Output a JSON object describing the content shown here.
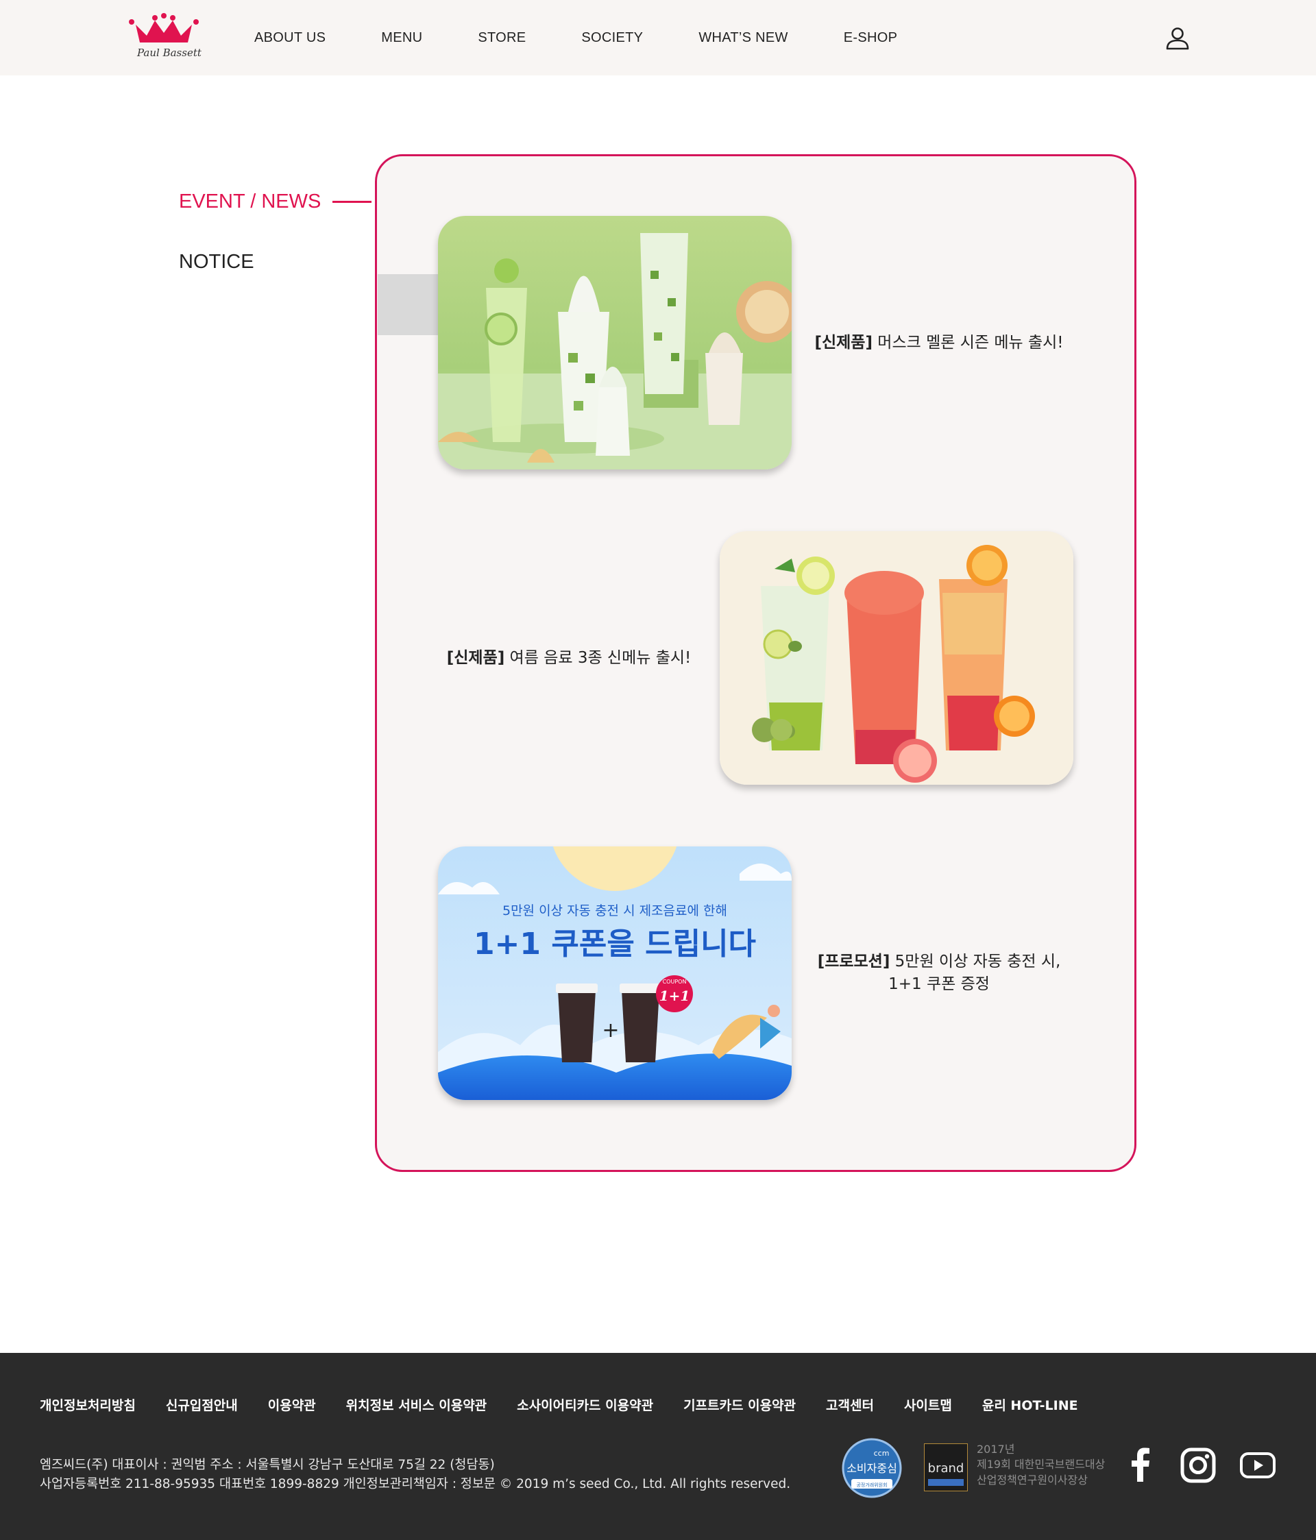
{
  "header": {
    "logo_text": "Paul Bassett",
    "nav": [
      "ABOUT US",
      "MENU",
      "STORE",
      "SOCIETY",
      "WHAT’S NEW",
      "E-SHOP"
    ]
  },
  "sidebar": {
    "active": "EVENT / NEWS",
    "notice": "NOTICE"
  },
  "posts": [
    {
      "tag": "[신제품]",
      "title": " 머스크 멜론 시즌 메뉴 출시!"
    },
    {
      "tag": "[신제품]",
      "title": " 여름 음료 3종 신메뉴 출시!"
    },
    {
      "tag": "[프로모션]",
      "title": " 5만원 이상 자동 충전 시,",
      "title2": "1+1 쿠폰 증정"
    }
  ],
  "promo_banner": {
    "subtitle": "5만원 이상 자동 충전 시 제조음료에 한해",
    "headline": "1+1 쿠폰을 드립니다",
    "coupon_label": "COUPON",
    "coupon_value": "1+1",
    "plus": "+"
  },
  "footer": {
    "links": [
      "개인정보처리방침",
      "신규입점안내",
      "이용약관",
      "위치정보 서비스 이용약관",
      "소사이어티카드 이용약관",
      "기프트카드 이용약관",
      "고객센터",
      "사이트맵",
      "윤리 HOT-LINE"
    ],
    "info_line1": "엠즈씨드(주) 대표이사 : 권익범 주소 : 서울특별시 강남구 도산대로 75길 22 (청담동)",
    "info_line2": "사업자등록번호 211-88-95935 대표번호 1899-8829 개인정보관리책임자 : 정보문 © 2019 m’s seed Co., Ltd. All rights reserved.",
    "ccm_top": "ccm",
    "ccm_main": "소비자중심",
    "ccm_bottom": "공정거래위원회",
    "award_year": "2017년",
    "award_line1": "제19회 대한민국브랜드대상",
    "award_line2": "산업정책연구원이사장상",
    "award_logo": "brand"
  },
  "colors": {
    "accent": "#e0134f",
    "panel_border": "#d4145a",
    "footer_bg": "#2b2b2b",
    "header_bg": "#f8f5f3"
  }
}
